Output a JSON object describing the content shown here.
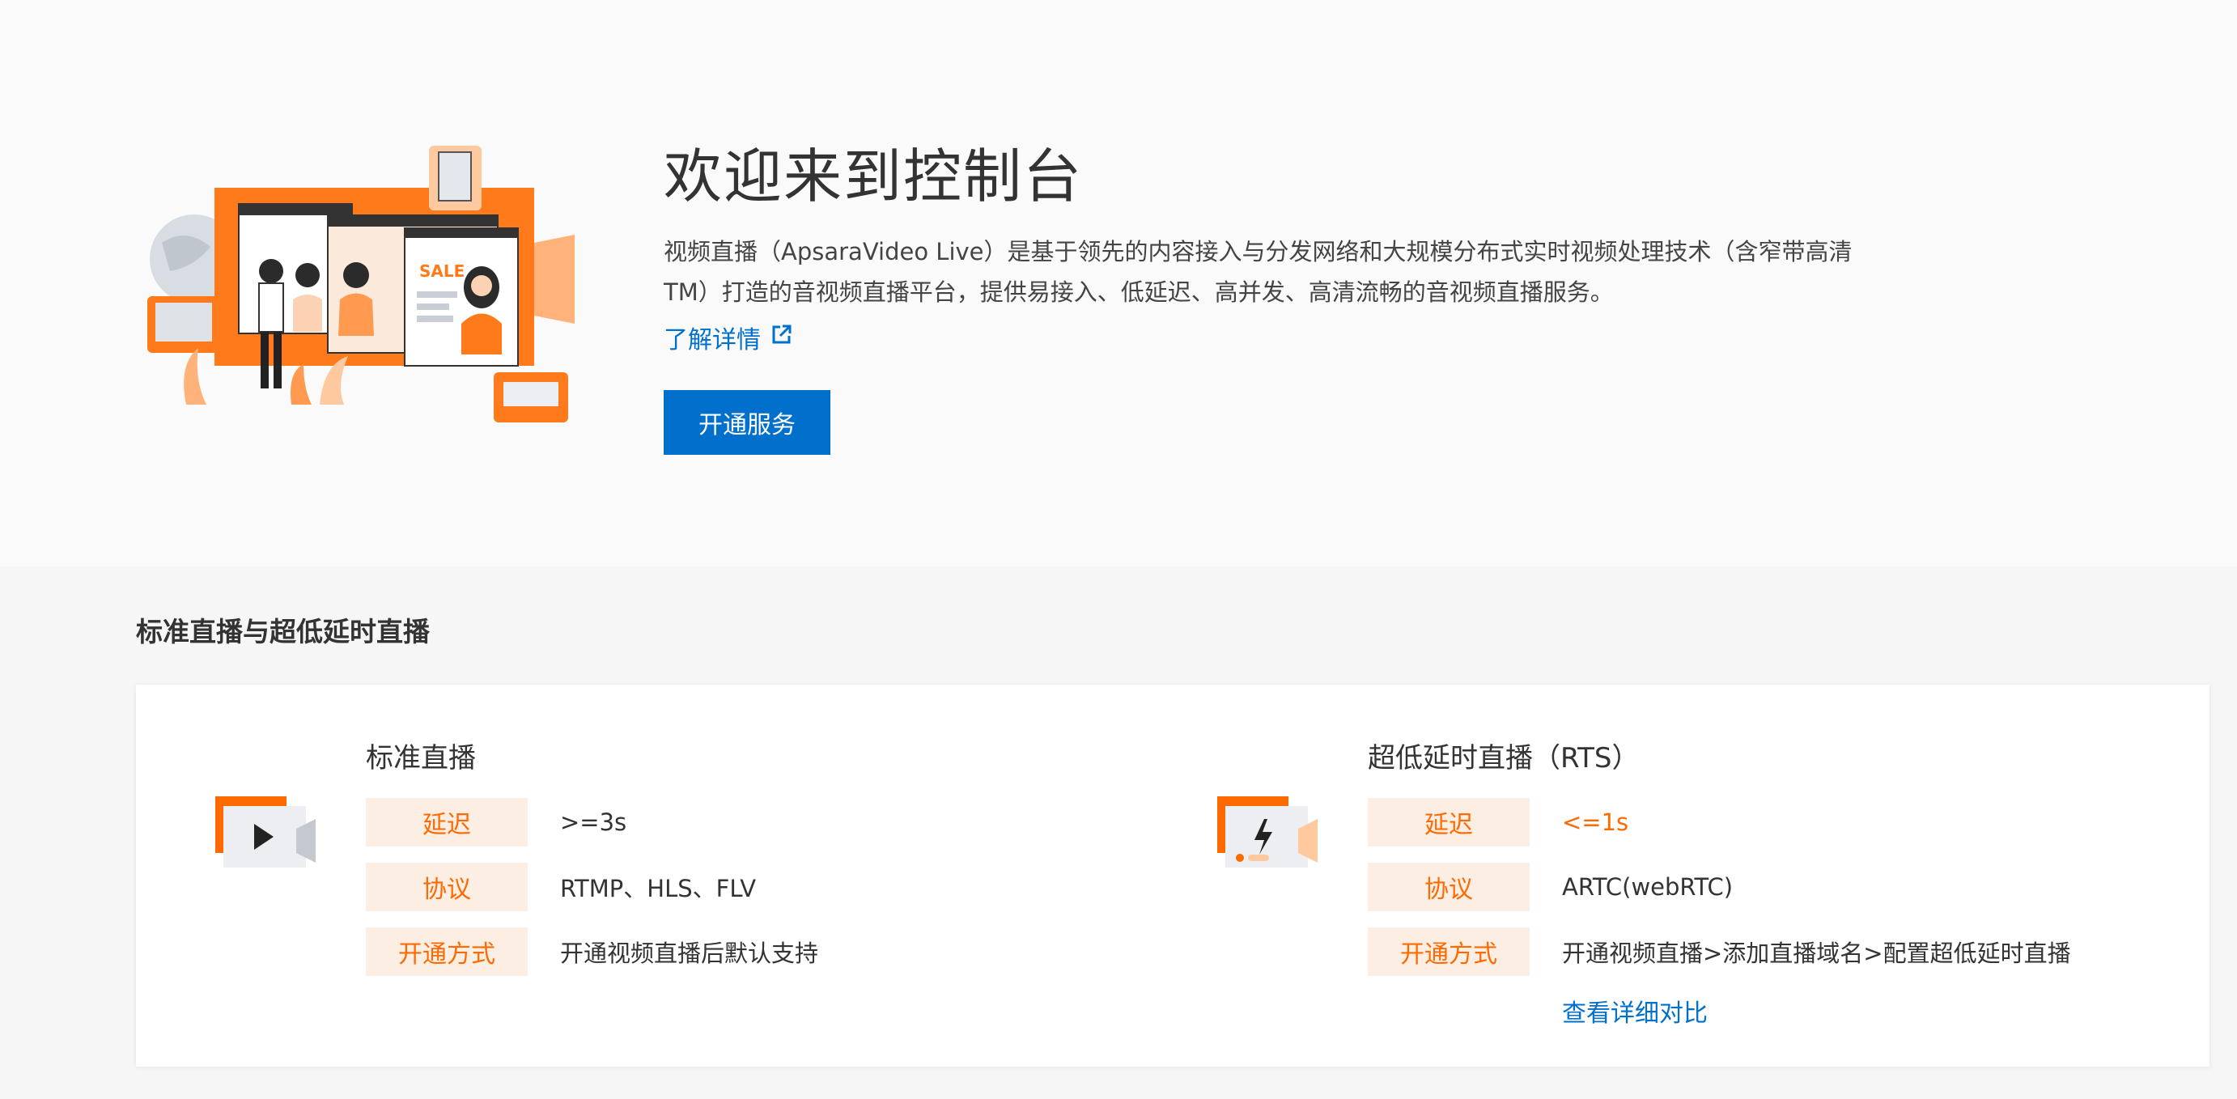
{
  "hero": {
    "title": "欢迎来到控制台",
    "description": "视频直播（ApsaraVideo Live）是基于领先的内容接入与分发网络和大规模分布式实时视频处理技术（含窄带高清TM）打造的音视频直播平台，提供易接入、低延迟、高并发、高清流畅的音视频直播服务。",
    "learn_more": "了解详情",
    "open_button": "开通服务",
    "illustration_text": "SALE"
  },
  "section": {
    "title": "标准直播与超低延时直播"
  },
  "standard": {
    "name": "标准直播",
    "rows": [
      {
        "label": "延迟",
        "value": ">=3s"
      },
      {
        "label": "协议",
        "value": "RTMP、HLS、FLV"
      },
      {
        "label": "开通方式",
        "value": "开通视频直播后默认支持"
      }
    ]
  },
  "rts": {
    "name": "超低延时直播（RTS）",
    "rows": [
      {
        "label": "延迟",
        "value": "<=1s"
      },
      {
        "label": "协议",
        "value": "ARTC(webRTC)"
      },
      {
        "label": "开通方式",
        "value": "开通视频直播>添加直播域名>配置超低延时直播"
      }
    ],
    "detail_link": "查看详细对比"
  },
  "colors": {
    "primary": "#0070cc",
    "accent": "#ff6a00",
    "label_bg": "#fdeee3"
  }
}
